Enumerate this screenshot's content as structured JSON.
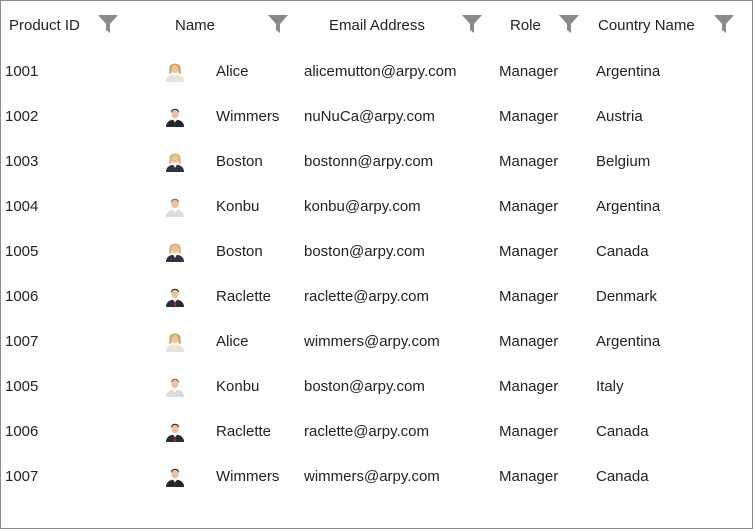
{
  "columns": [
    {
      "label": "Product ID",
      "filter_icon": "filter-funnel-icon"
    },
    {
      "label": "Name",
      "filter_icon": "filter-funnel-icon"
    },
    {
      "label": "Email Address",
      "filter_icon": "filter-funnel-icon"
    },
    {
      "label": "Role",
      "filter_icon": "filter-funnel-icon"
    },
    {
      "label": "Country Name",
      "filter_icon": "filter-funnel-icon"
    }
  ],
  "colors": {
    "filter_icon": "#8a8a8a",
    "border": "#8a8a8a",
    "text": "#222222"
  },
  "rows": [
    {
      "id": "1001",
      "avatar": "female-blonde-avatar-icon",
      "name": "Alice",
      "email": "alicemutton@arpy.com",
      "role": "Manager",
      "country": "Argentina"
    },
    {
      "id": "1002",
      "avatar": "male-suit-avatar-icon",
      "name": "Wimmers",
      "email": "nuNuCa@arpy.com",
      "role": "Manager",
      "country": "Austria"
    },
    {
      "id": "1003",
      "avatar": "female-business-avatar-icon",
      "name": "Boston",
      "email": "bostonn@arpy.com",
      "role": "Manager",
      "country": "Belgium"
    },
    {
      "id": "1004",
      "avatar": "male-light-avatar-icon",
      "name": "Konbu",
      "email": "konbu@arpy.com",
      "role": "Manager",
      "country": "Argentina"
    },
    {
      "id": "1005",
      "avatar": "female-business-avatar-icon",
      "name": "Boston",
      "email": "boston@arpy.com",
      "role": "Manager",
      "country": "Canada"
    },
    {
      "id": "1006",
      "avatar": "male-tie-avatar-icon",
      "name": "Raclette",
      "email": "raclette@arpy.com",
      "role": "Manager",
      "country": "Denmark"
    },
    {
      "id": "1007",
      "avatar": "female-blonde-avatar-icon",
      "name": "Alice",
      "email": "wimmers@arpy.com",
      "role": "Manager",
      "country": "Argentina"
    },
    {
      "id": "1005",
      "avatar": "male-light-avatar-icon",
      "name": "Konbu",
      "email": "boston@arpy.com",
      "role": "Manager",
      "country": "Italy"
    },
    {
      "id": "1006",
      "avatar": "male-tie-avatar-icon",
      "name": "Raclette",
      "email": "raclette@arpy.com",
      "role": "Manager",
      "country": "Canada"
    },
    {
      "id": "1007",
      "avatar": "male-suit-avatar-icon",
      "name": "Wimmers",
      "email": "wimmers@arpy.com",
      "role": "Manager",
      "country": "Canada"
    }
  ]
}
